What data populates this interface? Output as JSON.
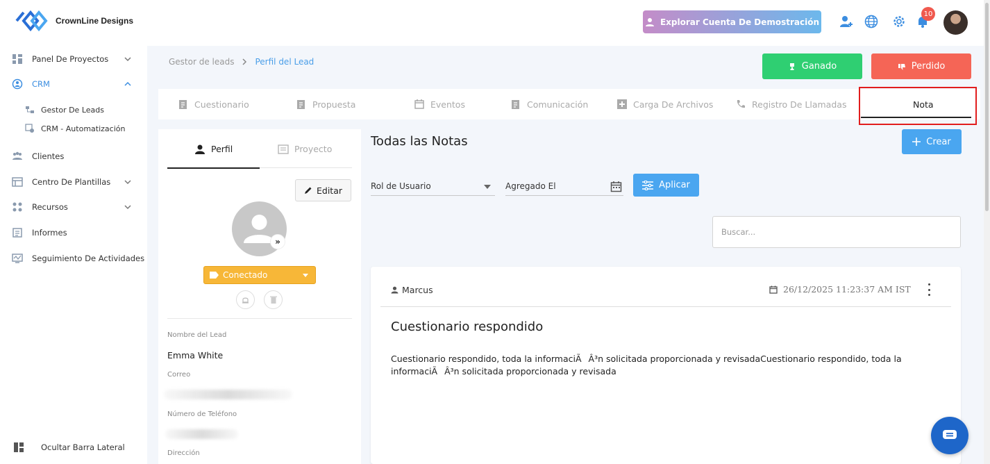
{
  "brand": {
    "name": "CrownLine Designs"
  },
  "header": {
    "demo_button": "Explorar Cuenta De Demostración",
    "notification_count": "10"
  },
  "sidebar": {
    "items": [
      {
        "label": "Panel De Proyectos",
        "icon": "dashboard-icon"
      },
      {
        "label": "CRM",
        "icon": "crm-icon"
      },
      {
        "label": "Clientes",
        "icon": "clients-icon"
      },
      {
        "label": "Centro De Plantillas",
        "icon": "templates-icon"
      },
      {
        "label": "Recursos",
        "icon": "resources-icon"
      },
      {
        "label": "Informes",
        "icon": "reports-icon"
      },
      {
        "label": "Seguimiento De Actividades",
        "icon": "activity-icon"
      }
    ],
    "crm_subitems": [
      {
        "label": "Gestor De Leads"
      },
      {
        "label": "CRM - Automatización"
      }
    ],
    "hide_label": "Ocultar Barra Lateral"
  },
  "breadcrumb": {
    "parent": "Gestor de leads",
    "current": "Perfil del Lead"
  },
  "actions": {
    "won": "Ganado",
    "lost": "Perdido"
  },
  "tabs": [
    {
      "label": "Cuestionario"
    },
    {
      "label": "Propuesta"
    },
    {
      "label": "Eventos"
    },
    {
      "label": "Comunicación"
    },
    {
      "label": "Carga De Archivos"
    },
    {
      "label": "Registro De Llamadas"
    },
    {
      "label": "Nota"
    }
  ],
  "profile": {
    "tab_profile": "Perfil",
    "tab_project": "Proyecto",
    "edit": "Editar",
    "status": "Conectado",
    "fields": {
      "name_label": "Nombre del Lead",
      "name_value": "Emma White",
      "email_label": "Correo",
      "phone_label": "Número de Teléfono",
      "address_label": "Dirección"
    }
  },
  "notes": {
    "title": "Todas las Notas",
    "create": "Crear",
    "filter_role": "Rol de Usuario",
    "filter_date": "Agregado El",
    "apply": "Aplicar",
    "search_placeholder": "Buscar...",
    "items": [
      {
        "author": "Marcus",
        "date": "26/12/2025 11:23:37 AM IST",
        "heading": "Cuestionario respondido",
        "body": "Cuestionario respondido, toda la informaciÃÂ³n solicitada proporcionada y revisadaCuestionario respondido, toda la informaciÃÂ³n solicitada proporcionada y revisada"
      }
    ]
  },
  "colors": {
    "primary": "#4aa6f0",
    "won": "#2fcf72",
    "lost": "#f56556",
    "status": "#f7b738",
    "highlight": "#e11d1d"
  }
}
